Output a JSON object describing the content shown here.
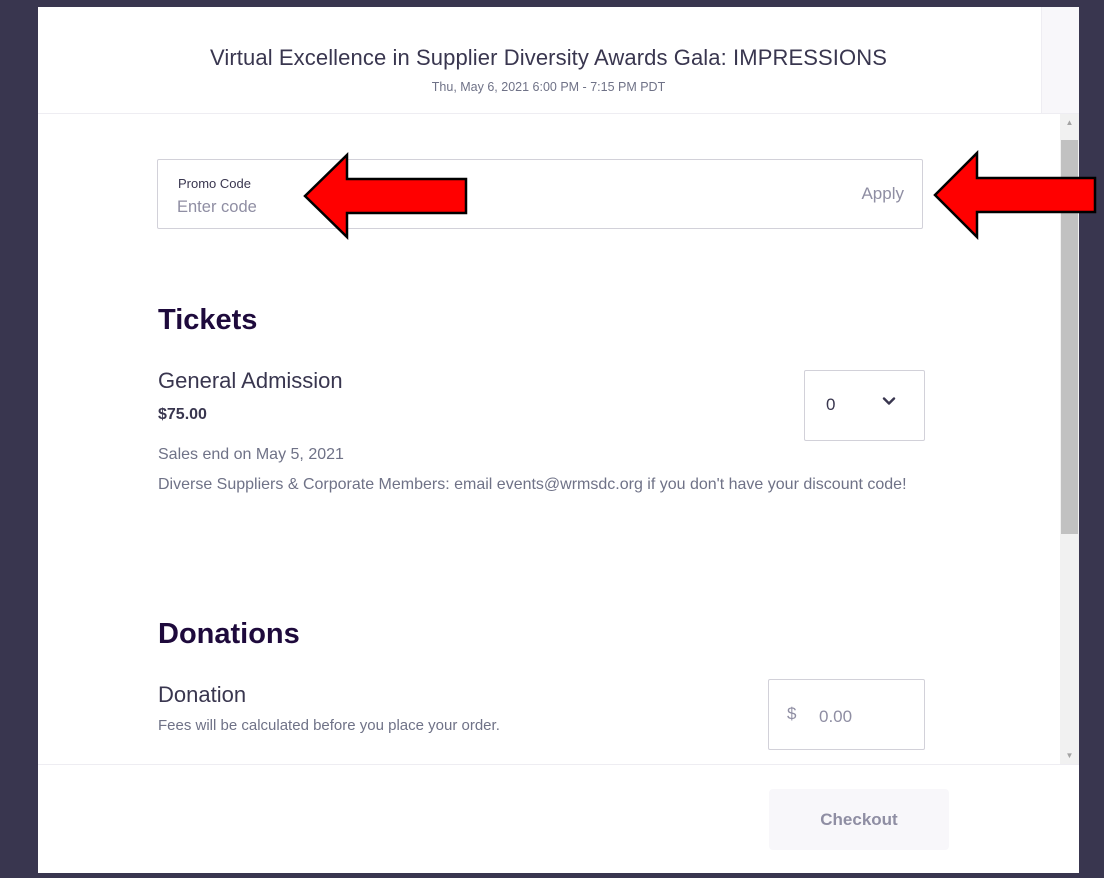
{
  "header": {
    "title": "Virtual Excellence in Supplier Diversity Awards Gala: IMPRESSIONS",
    "date": "Thu, May 6, 2021 6:00 PM - 7:15 PM PDT"
  },
  "promo": {
    "label": "Promo Code",
    "placeholder": "Enter code",
    "apply_label": "Apply"
  },
  "tickets": {
    "heading": "Tickets",
    "items": [
      {
        "name": "General Admission",
        "price": "$75.00",
        "quantity": "0",
        "sales_end": "Sales end on May 5, 2021",
        "description": "Diverse Suppliers & Corporate Members: email events@wrmsdc.org if you don't have your discount code!"
      }
    ]
  },
  "donations": {
    "heading": "Donations",
    "item": {
      "name": "Donation",
      "note": "Fees will be calculated before you place your order.",
      "currency": "$",
      "placeholder": "0.00"
    }
  },
  "footer": {
    "checkout_label": "Checkout"
  },
  "colors": {
    "frame": "#39364f",
    "heading": "#1e0a3c",
    "text": "#39364f",
    "muted": "#6f7287",
    "annotation_arrow": "#ff0000"
  }
}
